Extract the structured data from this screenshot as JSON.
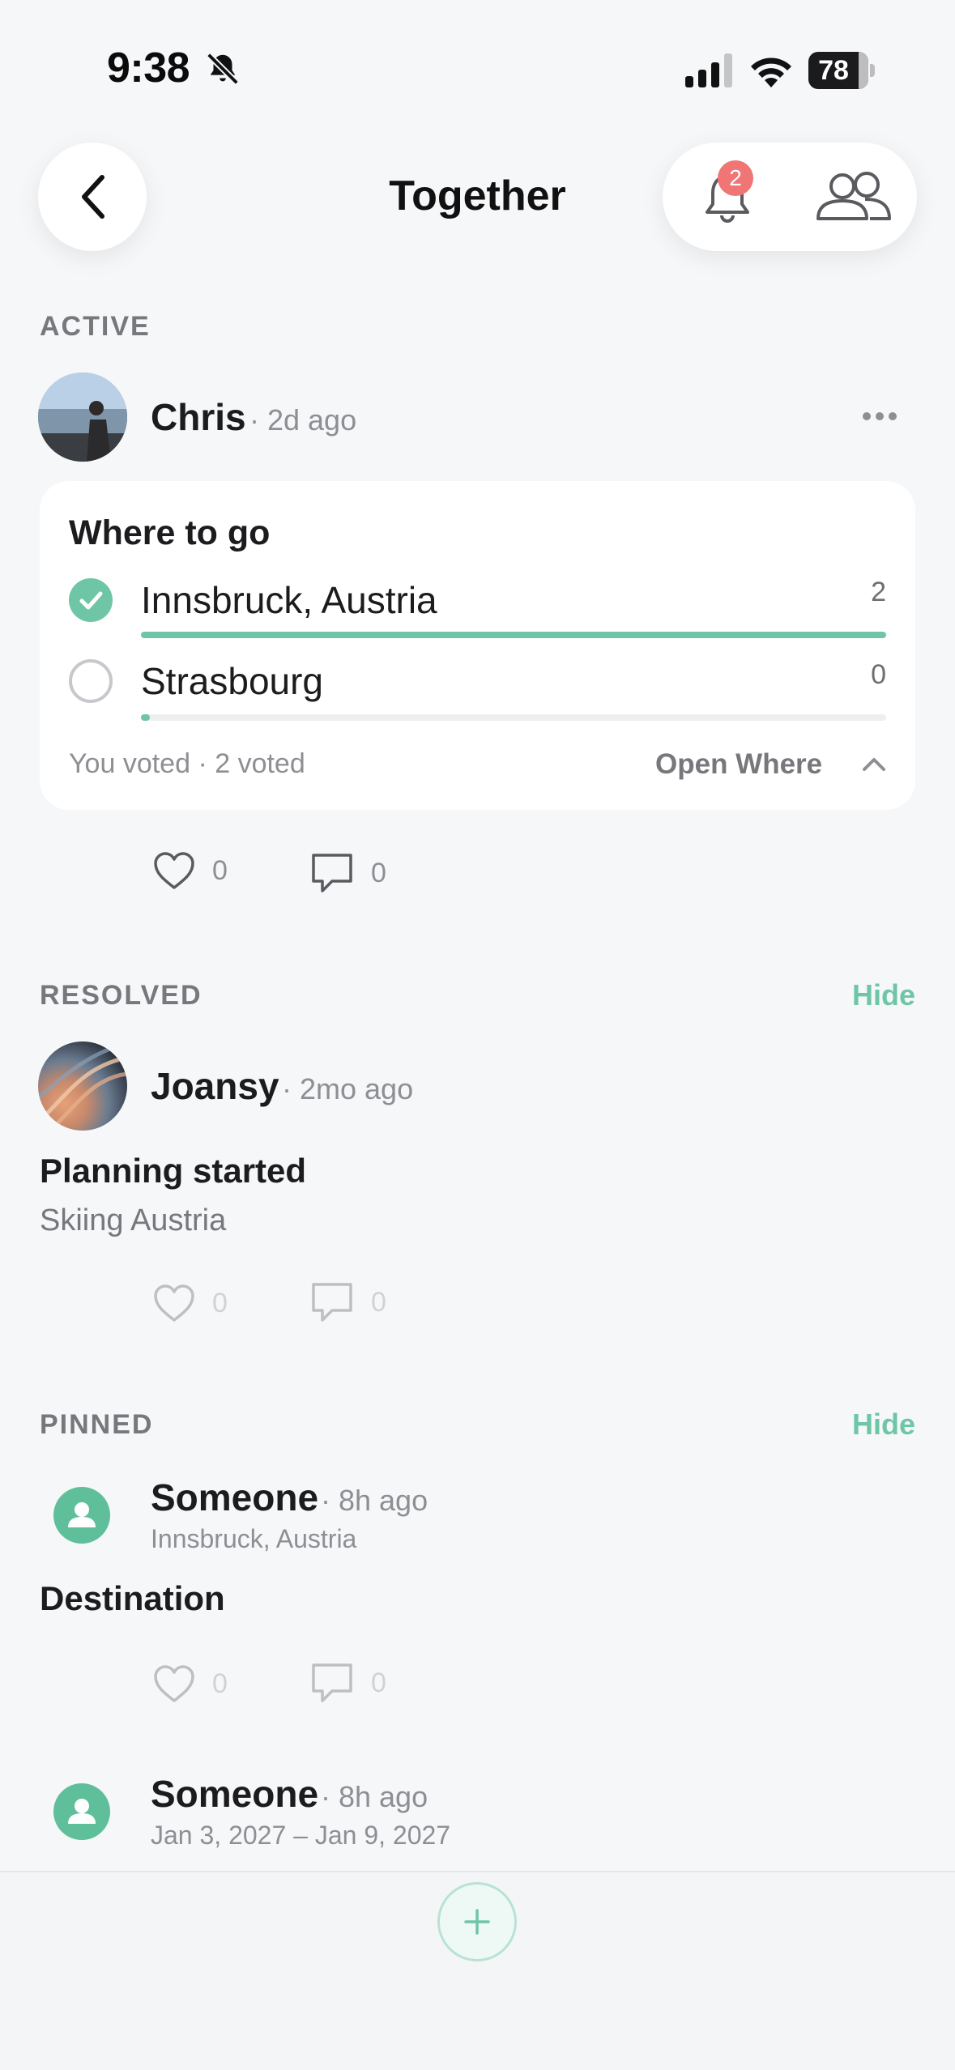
{
  "status_bar": {
    "time": "9:38",
    "battery": "78"
  },
  "header": {
    "title": "Together",
    "notification_count": "2"
  },
  "active": {
    "label": "ACTIVE",
    "post": {
      "author": "Chris",
      "time": "· 2d ago",
      "poll": {
        "title": "Where to go",
        "options": [
          {
            "label": "Innsbruck, Austria",
            "count": "2",
            "selected": true,
            "share": 1.0
          },
          {
            "label": "Strasbourg",
            "count": "0",
            "selected": false,
            "share": 0.0
          }
        ],
        "footer": "You voted · 2 voted",
        "open_label": "Open Where"
      },
      "likes": "0",
      "comments": "0"
    }
  },
  "resolved": {
    "label": "RESOLVED",
    "hide_label": "Hide",
    "post": {
      "author": "Joansy",
      "time": "· 2mo ago",
      "title": "Planning started",
      "subtitle": "Skiing Austria",
      "likes": "0",
      "comments": "0"
    }
  },
  "pinned": {
    "label": "PINNED",
    "hide_label": "Hide",
    "items": [
      {
        "author": "Someone",
        "time": "· 8h ago",
        "value": "Innsbruck, Austria",
        "title": "Destination",
        "likes": "0",
        "comments": "0"
      },
      {
        "author": "Someone",
        "time": "· 8h ago",
        "value": "Jan 3, 2027 – Jan 9, 2027"
      }
    ]
  },
  "colors": {
    "accent": "#6fc6a6",
    "badge": "#f07675",
    "background": "#f6f7f9"
  }
}
